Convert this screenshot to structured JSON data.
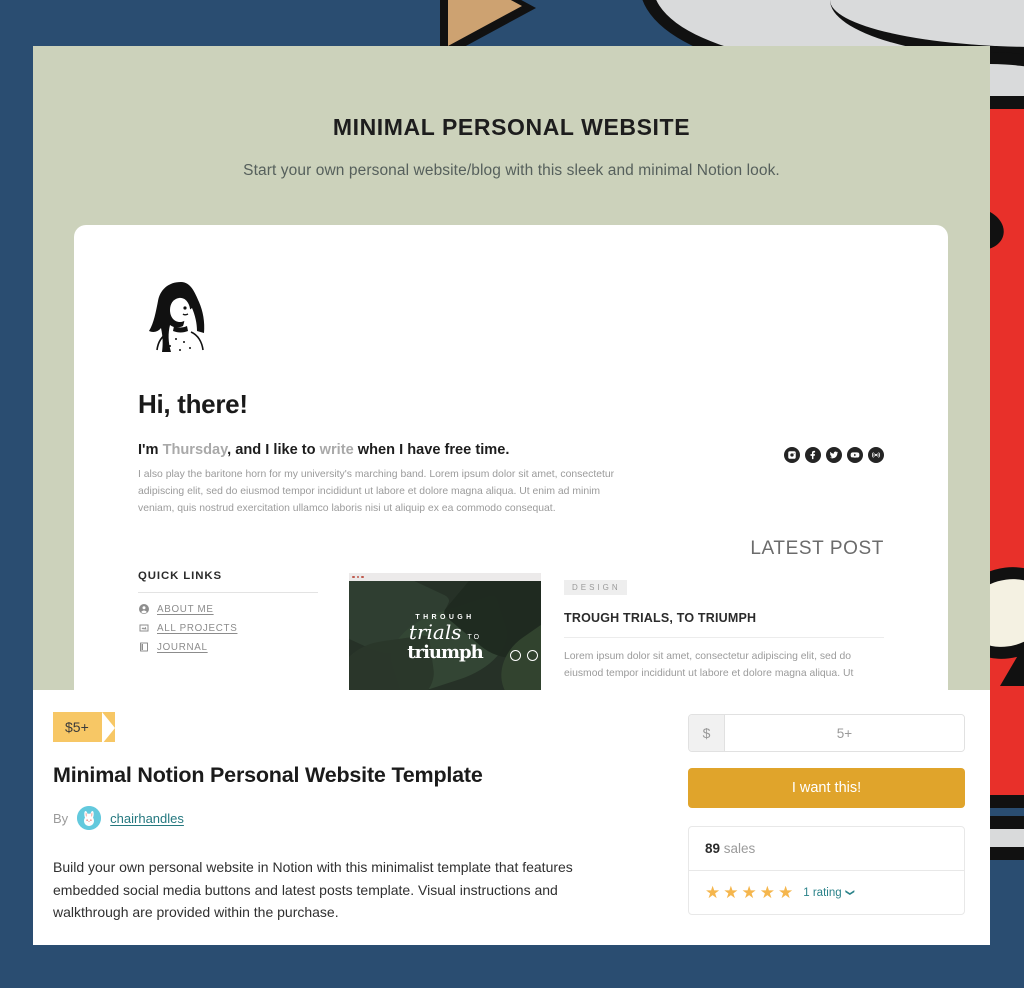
{
  "theme": {
    "page_background": "#2a4d71",
    "preview_background": "#ccd2bb",
    "accent_button": "#e0a42b",
    "price_tag": "#f7c765",
    "star_color": "#f5b64d",
    "link_color": "#24787f"
  },
  "preview": {
    "title": "MINIMAL PERSONAL WEBSITE",
    "subtitle": "Start your own personal website/blog with this sleek and minimal Notion look.",
    "site": {
      "avatar_name": "woman-line-art-avatar",
      "greeting": "Hi, there!",
      "intro_prefix": "I'm ",
      "intro_name": "Thursday",
      "intro_middle": ", and I like to ",
      "intro_verb": "write",
      "intro_suffix": " when I have free time.",
      "bio": "I also play the baritone horn for my university's marching band. Lorem ipsum dolor sit amet, consectetur adipiscing elit, sed do eiusmod tempor incididunt ut labore et dolore magna aliqua. Ut enim ad minim veniam, quis nostrud exercitation ullamco laboris nisi ut aliquip ex ea commodo consequat.",
      "socials": [
        {
          "name": "instagram-icon"
        },
        {
          "name": "facebook-icon"
        },
        {
          "name": "twitter-icon"
        },
        {
          "name": "youtube-icon"
        },
        {
          "name": "podcast-icon"
        }
      ],
      "quick_links_heading": "QUICK LINKS",
      "quick_links": [
        {
          "label": "ABOUT ME",
          "icon": "user-circle-icon"
        },
        {
          "label": "ALL PROJECTS",
          "icon": "image-stack-icon"
        },
        {
          "label": "JOURNAL",
          "icon": "book-icon"
        }
      ],
      "thumbnail": {
        "line1": "THROUGH",
        "line2": "trials",
        "line2_small": "TO",
        "line3": "triumph"
      },
      "latest_post_heading": "LATEST POST",
      "post": {
        "tag": "DESIGN",
        "title": "TROUGH TRIALS, TO TRIUMPH",
        "excerpt": "Lorem ipsum dolor sit amet, consectetur adipiscing elit, sed do eiusmod tempor incididunt ut labore et dolore magna aliqua. Ut"
      }
    }
  },
  "product": {
    "price_tag": "$5+",
    "title": "Minimal Notion Personal Website Template",
    "by_label": "By",
    "seller": "chairhandles",
    "description": "Build your own personal website in Notion with this minimalist template that features embedded social media buttons and latest posts template. Visual instructions and walkthrough are provided within the purchase."
  },
  "purchase": {
    "currency_symbol": "$",
    "price_value": "5+",
    "price_placeholder": "5+",
    "buy_button": "I want this!",
    "sales_count": "89",
    "sales_label": "sales",
    "stars": 5,
    "star_glyph": "★",
    "rating_label": "1 rating",
    "rating_chevron": "❯"
  }
}
